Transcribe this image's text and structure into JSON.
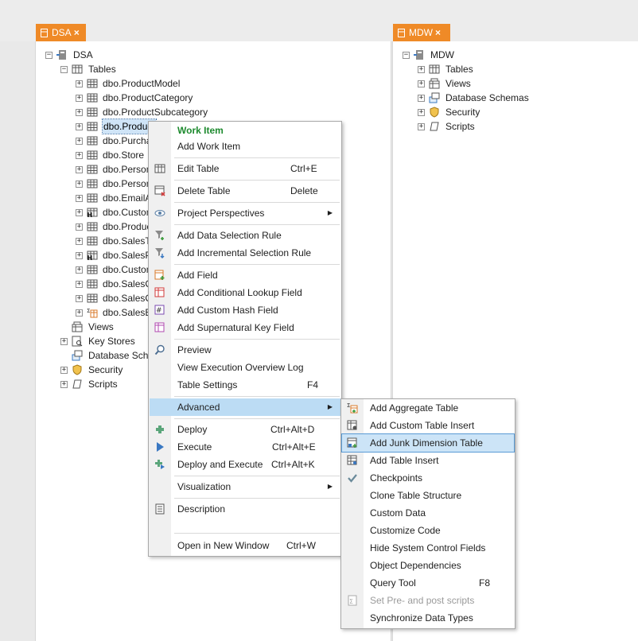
{
  "tabs": {
    "dsa": {
      "label": "DSA",
      "close": "×"
    },
    "mdw": {
      "label": "MDW",
      "close": "×"
    }
  },
  "dsa_tree": {
    "root": "DSA",
    "tables": "Tables",
    "table_items": [
      {
        "label": "dbo.ProductModel",
        "icon": "table-icon"
      },
      {
        "label": "dbo.ProductCategory",
        "icon": "table-icon"
      },
      {
        "label": "dbo.ProductSubcategory",
        "icon": "table-icon"
      },
      {
        "label": "dbo.Product",
        "icon": "table-icon",
        "selected": true
      },
      {
        "label": "dbo.Purchas",
        "icon": "table-icon"
      },
      {
        "label": "dbo.Store",
        "icon": "table-icon"
      },
      {
        "label": "dbo.Person",
        "icon": "table-icon"
      },
      {
        "label": "dbo.Personl",
        "icon": "table-icon"
      },
      {
        "label": "dbo.EmailAd",
        "icon": "table-icon"
      },
      {
        "label": "dbo.Custom",
        "icon": "history-table-icon"
      },
      {
        "label": "dbo.Product",
        "icon": "table-icon"
      },
      {
        "label": "dbo.SalesTe",
        "icon": "table-icon"
      },
      {
        "label": "dbo.SalesPe",
        "icon": "history-table-icon"
      },
      {
        "label": "dbo.Custom",
        "icon": "table-icon"
      },
      {
        "label": "dbo.SalesO",
        "icon": "table-icon"
      },
      {
        "label": "dbo.SalesO",
        "icon": "table-icon"
      },
      {
        "label": "dbo.SalesBy",
        "icon": "aggregate-table-icon"
      }
    ],
    "views": "Views",
    "key_stores": "Key Stores",
    "database_schemas": "Database Schen",
    "security": "Security",
    "scripts": "Scripts"
  },
  "mdw_tree": {
    "root": "MDW",
    "tables": "Tables",
    "views": "Views",
    "database_schemas": "Database Schemas",
    "security": "Security",
    "scripts": "Scripts"
  },
  "context_menu": {
    "work_item": "Work Item",
    "add_work_item": "Add Work Item",
    "edit_table": "Edit Table",
    "edit_table_key": "Ctrl+E",
    "delete_table": "Delete Table",
    "delete_table_key": "Delete",
    "project_perspectives": "Project Perspectives",
    "add_data_selection_rule": "Add Data Selection Rule",
    "add_incremental_selection_rule": "Add Incremental Selection Rule",
    "add_field": "Add Field",
    "add_conditional_lookup_field": "Add Conditional Lookup Field",
    "add_custom_hash_field": "Add Custom Hash Field",
    "add_supernatural_key_field": "Add Supernatural Key Field",
    "preview": "Preview",
    "view_execution_overview_log": "View Execution Overview Log",
    "table_settings": "Table Settings",
    "table_settings_key": "F4",
    "advanced": "Advanced",
    "deploy": "Deploy",
    "deploy_key": "Ctrl+Alt+D",
    "execute": "Execute",
    "execute_key": "Ctrl+Alt+E",
    "deploy_and_execute": "Deploy and Execute",
    "deploy_and_execute_key": "Ctrl+Alt+K",
    "visualization": "Visualization",
    "description": "Description",
    "open_in_new_window": "Open in New Window",
    "open_in_new_window_key": "Ctrl+W",
    "arrow": "▶"
  },
  "advanced_submenu": {
    "add_aggregate_table": "Add Aggregate Table",
    "add_custom_table_insert": "Add Custom Table Insert",
    "add_junk_dimension_table": "Add Junk Dimension Table",
    "add_table_insert": "Add Table Insert",
    "checkpoints": "Checkpoints",
    "clone_table_structure": "Clone Table Structure",
    "custom_data": "Custom Data",
    "customize_code": "Customize Code",
    "hide_system_control_fields": "Hide System Control Fields",
    "object_dependencies": "Object Dependencies",
    "query_tool": "Query Tool",
    "query_tool_key": "F8",
    "set_pre_post_scripts": "Set Pre- and post scripts",
    "synchronize_data_types": "Synchronize Data Types"
  },
  "colors": {
    "tab_orange": "#ef8a27",
    "work_item_green": "#1d8a2e",
    "highlight_blue": "#bcdcf4"
  }
}
